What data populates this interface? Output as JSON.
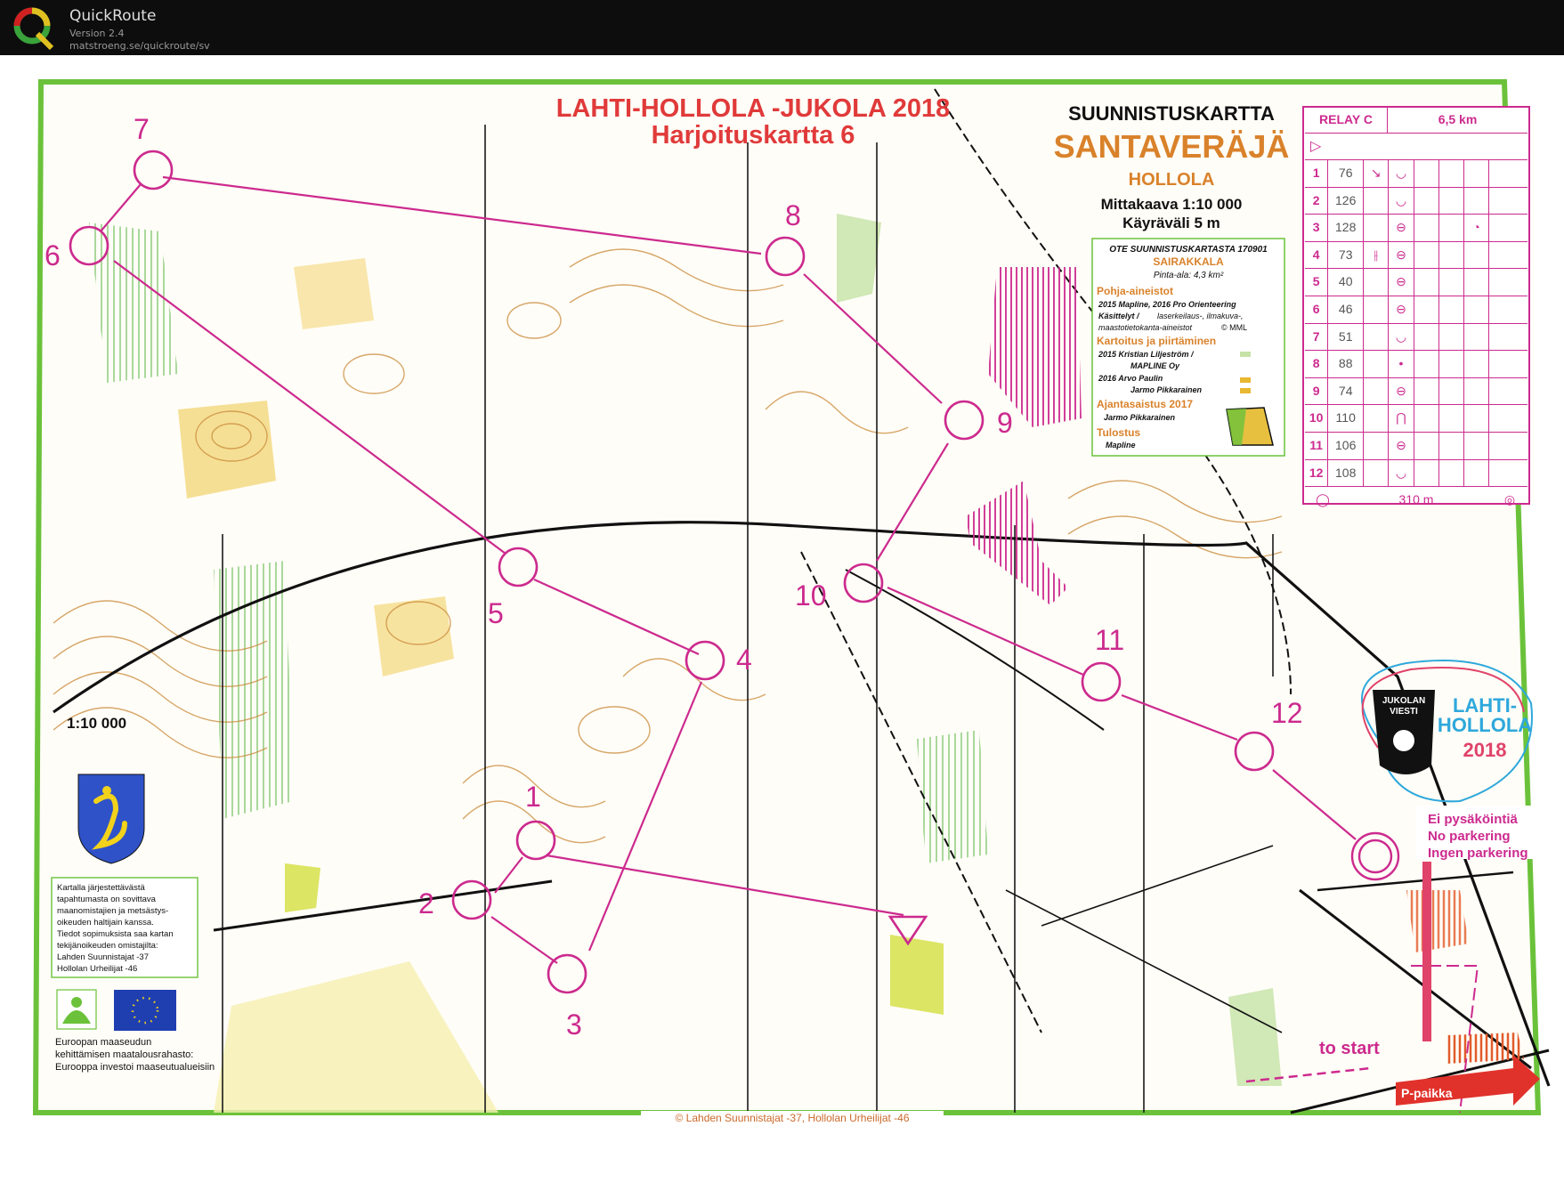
{
  "app": {
    "name": "QuickRoute",
    "version": "Version 2.4",
    "url": "matstroeng.se/quickroute/sv"
  },
  "map_title": {
    "line1": "LAHTI-HOLLOLA -JUKOLA 2018",
    "line2": "Harjoituskartta 6"
  },
  "map_header": {
    "type": "SUUNNISTUSKARTTA",
    "name": "SANTAVERÄJÄ",
    "place": "HOLLOLA",
    "scale": "Mittakaava 1:10 000",
    "contour": "Käyräväli 5 m"
  },
  "info_box": {
    "extract": "OTE SUUNNISTUSKARTASTA 170901",
    "area": "SAIRAKKALA",
    "size": "Pinta-ala: 4,3 km²",
    "base_heading": "Pohja-aineistot",
    "base_line1": "2015 Mapline, 2016 Pro Orienteering",
    "base_line2": "Käsittelyt /",
    "base_line3": "laserkeilaus-, ilmakuva-,",
    "base_line4": "maastotietokanta-aineistot",
    "base_mml": "© MML",
    "mapping_heading": "Kartoitus ja piirtäminen",
    "mapping_line1": "2015 Kristian Liljeström /",
    "mapping_line2": "MAPLINE Oy",
    "mapping_line3": "2016 Arvo Paulin",
    "mapping_line4": "Jarmo Pikkarainen",
    "update_heading": "Ajantasaistus 2017",
    "update_line": "Jarmo Pikkarainen",
    "print_heading": "Tulostus",
    "print_line": "Mapline"
  },
  "control_card": {
    "relay": "RELAY C",
    "length": "6,5 km",
    "finish_distance": "310 m",
    "rows": [
      {
        "n": "1",
        "code": "76",
        "dir": "↘",
        "feat": "◡",
        "extra": ""
      },
      {
        "n": "2",
        "code": "126",
        "dir": "",
        "feat": "◡",
        "extra": ""
      },
      {
        "n": "3",
        "code": "128",
        "dir": "",
        "feat": "⊖",
        "extra": "◔"
      },
      {
        "n": "4",
        "code": "73",
        "dir": "⫲",
        "feat": "⊖",
        "extra": ""
      },
      {
        "n": "5",
        "code": "40",
        "dir": "",
        "feat": "⊖",
        "extra": ""
      },
      {
        "n": "6",
        "code": "46",
        "dir": "",
        "feat": "⊖",
        "extra": ""
      },
      {
        "n": "7",
        "code": "51",
        "dir": "",
        "feat": "◡",
        "extra": ""
      },
      {
        "n": "8",
        "code": "88",
        "dir": "",
        "feat": "•",
        "extra": ""
      },
      {
        "n": "9",
        "code": "74",
        "dir": "",
        "feat": "⊖",
        "extra": ""
      },
      {
        "n": "10",
        "code": "110",
        "dir": "",
        "feat": "⋂",
        "extra": ""
      },
      {
        "n": "11",
        "code": "106",
        "dir": "",
        "feat": "⊖",
        "extra": ""
      },
      {
        "n": "12",
        "code": "108",
        "dir": "",
        "feat": "◡",
        "extra": ""
      }
    ]
  },
  "course": {
    "controls": [
      {
        "label": "1"
      },
      {
        "label": "2"
      },
      {
        "label": "3"
      },
      {
        "label": "4"
      },
      {
        "label": "5"
      },
      {
        "label": "6"
      },
      {
        "label": "7"
      },
      {
        "label": "8"
      },
      {
        "label": "9"
      },
      {
        "label": "10"
      },
      {
        "label": "11"
      },
      {
        "label": "12"
      }
    ]
  },
  "scale_text": "1:10 000",
  "permission_text": {
    "l1": "Kartalla järjestettävästä",
    "l2": "tapahtumasta on sovittava",
    "l3": "maanomistajien ja metsästys-",
    "l4": "oikeuden haltijain kanssa.",
    "l5": "Tiedot sopimuksista saa kartan",
    "l6": "tekijänoikeuden omistajilta:",
    "l7": "Lahden Suunnistajat -37",
    "l8": "Hollolan Urheilijat -46"
  },
  "eu_text": {
    "l1": "Euroopan maaseudun",
    "l2": "kehittämisen maatalousrahasto:",
    "l3": "Eurooppa investoi maaseutualueisiin"
  },
  "parking_note": {
    "l1": "Ei pysäköintiä",
    "l2": "No parkering",
    "l3": "Ingen parkering"
  },
  "to_start": "to start",
  "parking_arrow": "P-paikka",
  "copyright": "© Lahden Suunnistajat -37, Hollolan Urheilijat -46",
  "logo": {
    "l1": "JUKOLAN",
    "l2": "VIESTI",
    "l3": "LAHTI-",
    "l4": "HOLLOLA",
    "l5": "2018"
  },
  "colors": {
    "course": "#cc2a8e",
    "border": "#6bc23a",
    "contour": "#c98a3a",
    "title_red": "#e03a3a",
    "orange": "#d9822b",
    "yellow": "#f3d77a",
    "green": "#c6e2a6"
  }
}
